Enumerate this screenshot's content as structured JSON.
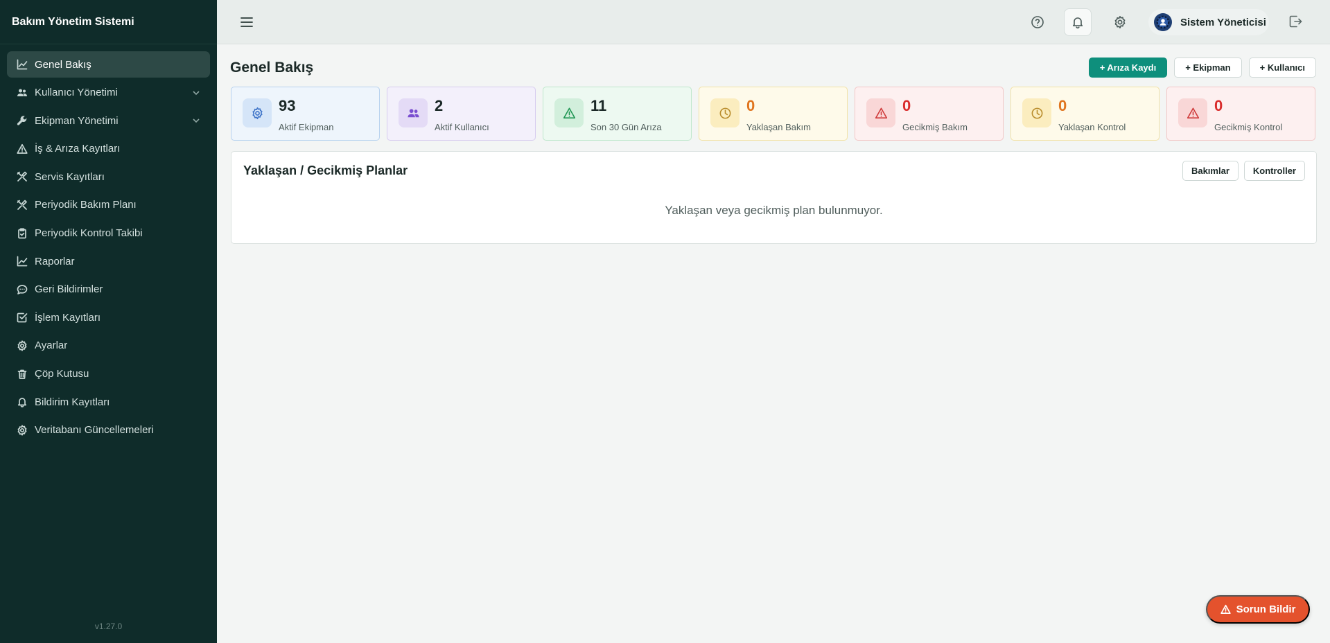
{
  "app": {
    "title": "Bakım Yönetim Sistemi",
    "version": "v1.27.0"
  },
  "sidebar": {
    "items": [
      {
        "label": "Genel Bakış",
        "icon": "chart-line-icon",
        "active": true
      },
      {
        "label": "Kullanıcı Yönetimi",
        "icon": "users-icon",
        "expandable": true
      },
      {
        "label": "Ekipman Yönetimi",
        "icon": "wrench-icon",
        "expandable": true
      },
      {
        "label": "İş & Arıza Kayıtları",
        "icon": "warning-icon"
      },
      {
        "label": "Servis Kayıtları",
        "icon": "tools-icon"
      },
      {
        "label": "Periyodik Bakım Planı",
        "icon": "tools-icon"
      },
      {
        "label": "Periyodik Kontrol Takibi",
        "icon": "clipboard-icon"
      },
      {
        "label": "Raporlar",
        "icon": "chart-line-icon"
      },
      {
        "label": "Geri Bildirimler",
        "icon": "message-icon"
      },
      {
        "label": "İşlem Kayıtları",
        "icon": "check-square-icon"
      },
      {
        "label": "Ayarlar",
        "icon": "gear-icon"
      },
      {
        "label": "Çöp Kutusu",
        "icon": "trash-icon"
      },
      {
        "label": "Bildirim Kayıtları",
        "icon": "bell-icon"
      },
      {
        "label": "Veritabanı Güncellemeleri",
        "icon": "gear-icon"
      }
    ]
  },
  "topbar": {
    "user_name": "Sistem Yöneticisi"
  },
  "main": {
    "title": "Genel Bakış",
    "actions": {
      "fault": "+ Arıza Kaydı",
      "equipment": "+ Ekipman",
      "user": "+ Kullanıcı"
    },
    "stats": [
      {
        "value": "93",
        "label": "Aktif Ekipman",
        "icon": "gear-icon",
        "color": "#3f74c8"
      },
      {
        "value": "2",
        "label": "Aktif Kullanıcı",
        "icon": "users-icon",
        "color": "#7a4ed0"
      },
      {
        "value": "11",
        "label": "Son 30 Gün Arıza",
        "icon": "warning-icon",
        "color": "#1f9653"
      },
      {
        "value": "0",
        "label": "Yaklaşan Bakım",
        "icon": "clock-icon",
        "color": "#e0751f"
      },
      {
        "value": "0",
        "label": "Gecikmiş Bakım",
        "icon": "warning-icon",
        "color": "#d92c2c"
      },
      {
        "value": "0",
        "label": "Yaklaşan Kontrol",
        "icon": "clock-icon",
        "color": "#e0751f"
      },
      {
        "value": "0",
        "label": "Gecikmiş Kontrol",
        "icon": "warning-icon",
        "color": "#d92c2c"
      }
    ],
    "panel": {
      "title": "Yaklaşan / Gecikmiş Planlar",
      "btn_maintenance": "Bakımlar",
      "btn_controls": "Kontroller",
      "empty": "Yaklaşan veya gecikmiş plan bulunmuyor."
    }
  },
  "fab": {
    "label": "Sorun Bildir"
  }
}
